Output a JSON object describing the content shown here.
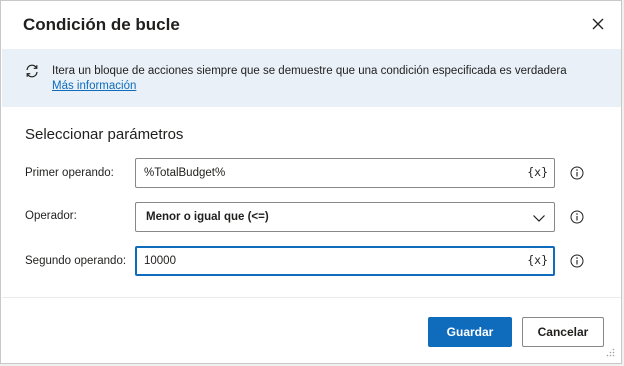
{
  "dialog": {
    "title": "Condición de bucle",
    "close_icon": "close-icon"
  },
  "info": {
    "icon": "loop-icon",
    "description": "Itera un bloque de acciones siempre que se demuestre que una condición especificada es verdadera",
    "more_link": "Más información"
  },
  "section": {
    "title": "Seleccionar parámetros"
  },
  "fields": {
    "first_operand": {
      "label": "Primer operando:",
      "value": "%TotalBudget%",
      "var_button": "{x}"
    },
    "operator": {
      "label": "Operador:",
      "value": "Menor o igual que (<=)"
    },
    "second_operand": {
      "label": "Segundo operando:",
      "value": "10000",
      "var_button": "{x}"
    }
  },
  "buttons": {
    "save": "Guardar",
    "cancel": "Cancelar"
  },
  "colors": {
    "accent": "#0f6cbd",
    "banner": "#e9f0f8"
  }
}
